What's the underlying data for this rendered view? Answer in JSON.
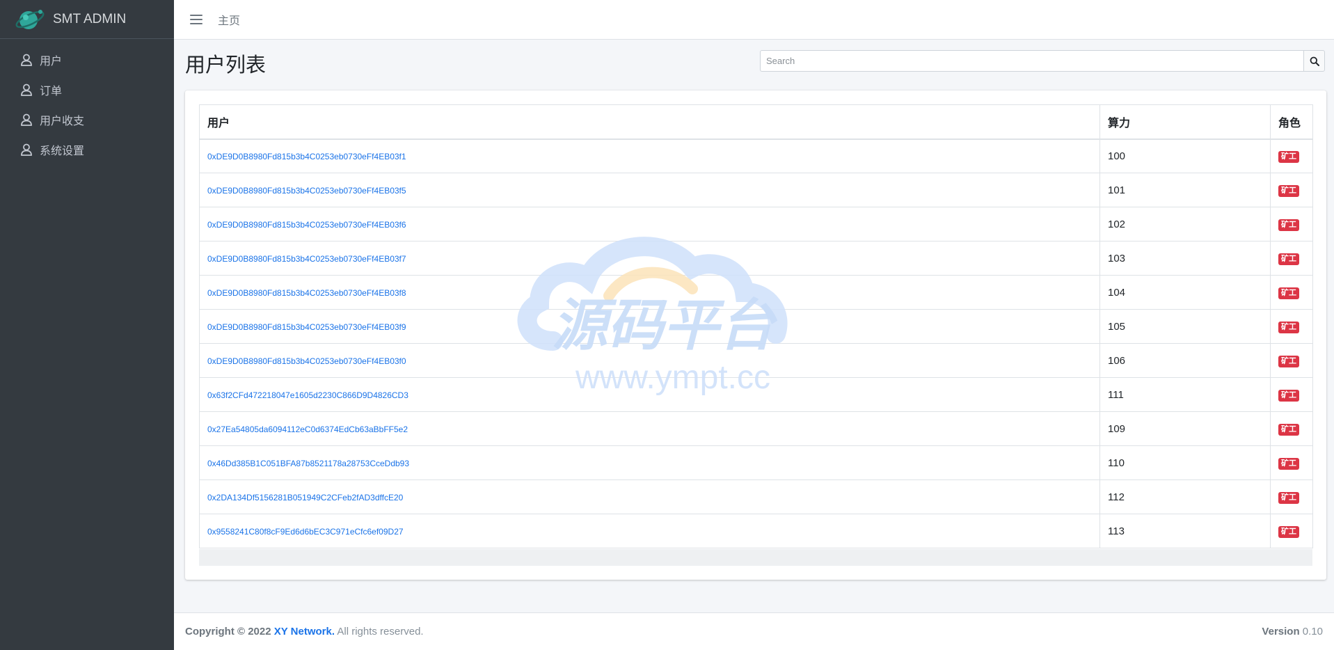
{
  "brand": {
    "name": "SMT ADMIN"
  },
  "sidebar": {
    "items": [
      {
        "label": "用户",
        "icon": "user-icon"
      },
      {
        "label": "订单",
        "icon": "user-icon"
      },
      {
        "label": "用户收支",
        "icon": "user-icon"
      },
      {
        "label": "系统设置",
        "icon": "user-icon"
      }
    ]
  },
  "topbar": {
    "home_label": "主页"
  },
  "page": {
    "title": "用户列表"
  },
  "search": {
    "placeholder": "Search"
  },
  "table": {
    "headers": {
      "user": "用户",
      "power": "算力",
      "role": "角色"
    },
    "rows": [
      {
        "user": "0xDE9D0B8980Fd815b3b4C0253eb0730eFf4EB03f1",
        "power": "100",
        "role": "矿工"
      },
      {
        "user": "0xDE9D0B8980Fd815b3b4C0253eb0730eFf4EB03f5",
        "power": "101",
        "role": "矿工"
      },
      {
        "user": "0xDE9D0B8980Fd815b3b4C0253eb0730eFf4EB03f6",
        "power": "102",
        "role": "矿工"
      },
      {
        "user": "0xDE9D0B8980Fd815b3b4C0253eb0730eFf4EB03f7",
        "power": "103",
        "role": "矿工"
      },
      {
        "user": "0xDE9D0B8980Fd815b3b4C0253eb0730eFf4EB03f8",
        "power": "104",
        "role": "矿工"
      },
      {
        "user": "0xDE9D0B8980Fd815b3b4C0253eb0730eFf4EB03f9",
        "power": "105",
        "role": "矿工"
      },
      {
        "user": "0xDE9D0B8980Fd815b3b4C0253eb0730eFf4EB03f0",
        "power": "106",
        "role": "矿工"
      },
      {
        "user": "0x63f2CFd472218047e1605d2230C866D9D4826CD3",
        "power": "111",
        "role": "矿工"
      },
      {
        "user": "0x27Ea54805da6094112eC0d6374EdCb63aBbFF5e2",
        "power": "109",
        "role": "矿工"
      },
      {
        "user": "0x46Dd385B1C051BFA87b8521178a28753CceDdb93",
        "power": "110",
        "role": "矿工"
      },
      {
        "user": "0x2DA134Df5156281B051949C2CFeb2fAD3dffcE20",
        "power": "112",
        "role": "矿工"
      },
      {
        "user": "0x9558241C80f8cF9Ed6d6bEC3C971eCfc6ef09D27",
        "power": "113",
        "role": "矿工"
      }
    ]
  },
  "watermark": {
    "title": "源码平台",
    "url": "www.ympt.cc"
  },
  "footer": {
    "copyright": "Copyright © 2022",
    "company": "XY Network.",
    "rights": "All rights reserved.",
    "version_label": "Version",
    "version": "0.10"
  },
  "colors": {
    "sidebar_bg": "#343a40",
    "link": "#1a73e8",
    "badge_danger": "#dc3545",
    "page_bg": "#f4f6f9"
  }
}
